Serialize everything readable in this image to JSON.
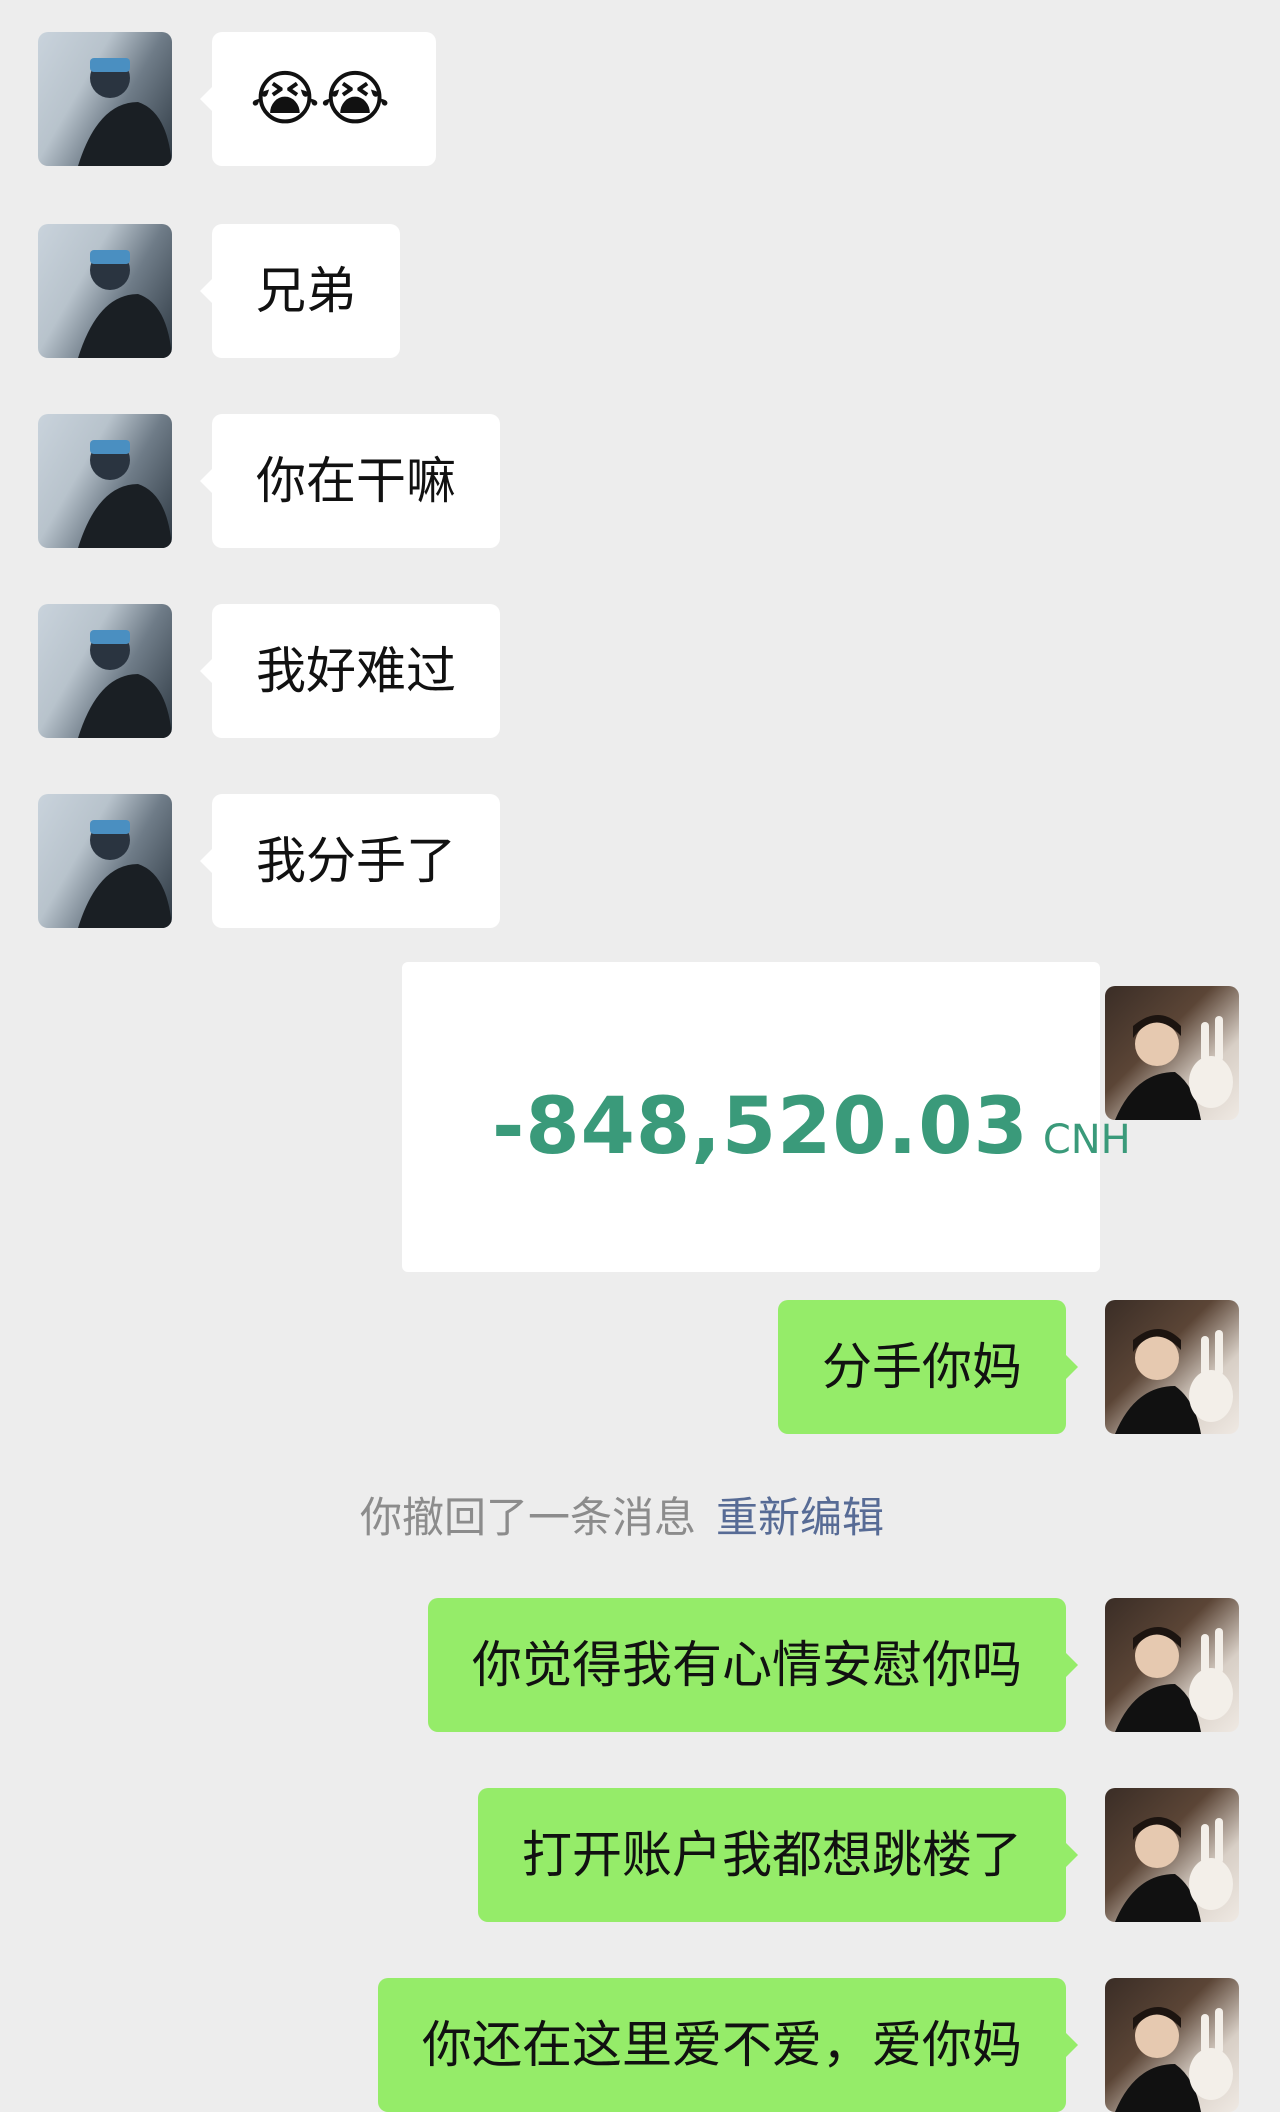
{
  "messages": [
    {
      "side": "left",
      "text": "😭😭",
      "kind": "emoji"
    },
    {
      "side": "left",
      "text": "兄弟"
    },
    {
      "side": "left",
      "text": "你在干嘛"
    },
    {
      "side": "left",
      "text": "我好难过"
    },
    {
      "side": "left",
      "text": "我分手了"
    },
    {
      "side": "right",
      "kind": "image",
      "amount": "-848,520.03",
      "currency": "CNH"
    },
    {
      "side": "right",
      "text": "分手你妈"
    },
    {
      "side": "system",
      "text": "你撤回了一条消息",
      "action": "重新编辑"
    },
    {
      "side": "right",
      "text": "你觉得我有心情安慰你吗"
    },
    {
      "side": "right",
      "text": "打开账户我都想跳楼了"
    },
    {
      "side": "right",
      "text": "你还在这里爱不爱，爱你妈"
    }
  ],
  "colors": {
    "background": "#ededed",
    "incoming_bubble": "#ffffff",
    "outgoing_bubble": "#95ec69",
    "amount_color": "#3a9a7a",
    "link_color": "#576b95"
  },
  "icons": {
    "left_avatar": "person-on-boat-avatar",
    "right_avatar": "person-with-bunny-avatar"
  }
}
